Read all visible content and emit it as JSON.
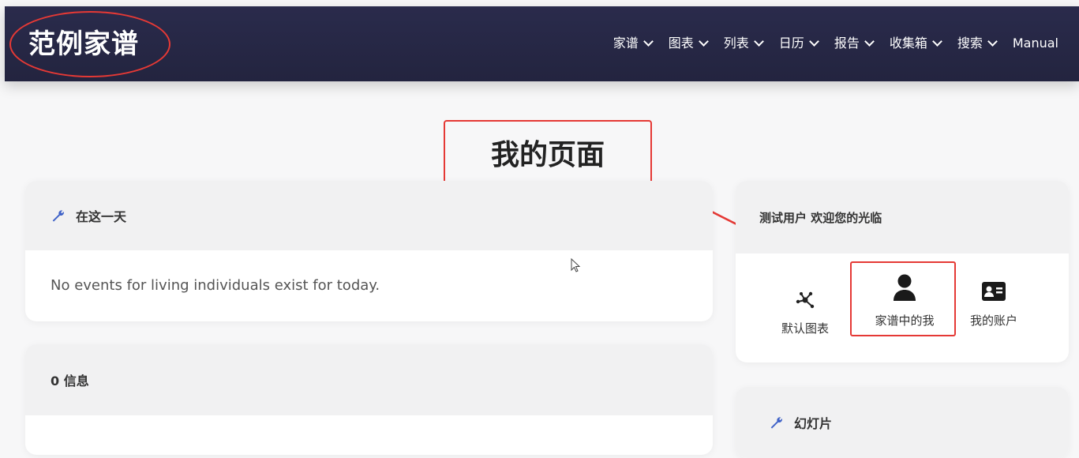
{
  "brand": {
    "title": "范例家谱"
  },
  "nav": {
    "items": [
      {
        "label": "家谱"
      },
      {
        "label": "图表"
      },
      {
        "label": "列表"
      },
      {
        "label": "日历"
      },
      {
        "label": "报告"
      },
      {
        "label": "收集箱"
      },
      {
        "label": "搜索"
      },
      {
        "label": "Manual"
      }
    ]
  },
  "annotation": {
    "callout": "我的页面",
    "color": "#e53935"
  },
  "today_card": {
    "title": "在这一天",
    "message": "No events for living individuals exist for today.",
    "icon": "wrench-icon"
  },
  "info_card": {
    "title": "0 信息"
  },
  "welcome_card": {
    "title": "测试用户 欢迎您的光临",
    "links": [
      {
        "label": "默认图表",
        "icon": "chart-nodes-icon"
      },
      {
        "label": "家谱中的我",
        "icon": "person-icon"
      },
      {
        "label": "我的账户",
        "icon": "id-card-icon"
      }
    ]
  },
  "slides_card": {
    "title": "幻灯片",
    "icon": "wrench-icon"
  },
  "colors": {
    "navbar": "#26274a",
    "accent": "#3f62c8",
    "annotation": "#e53935",
    "background": "#f7f7f8"
  }
}
